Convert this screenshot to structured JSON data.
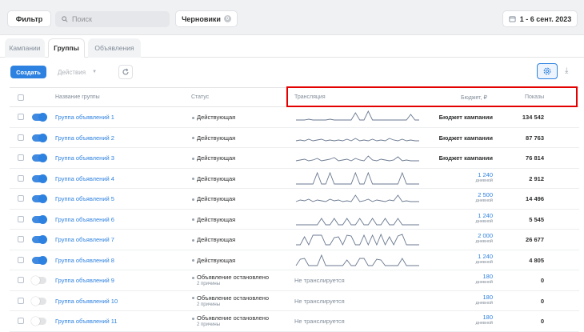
{
  "toolbar": {
    "filter_label": "Фильтр",
    "search_placeholder": "Поиск",
    "drafts_label": "Черновики",
    "drafts_count": "0",
    "date_range": "1 - 6 сент. 2023"
  },
  "tabs": [
    {
      "label": "Кампании",
      "active": false
    },
    {
      "label": "Группы",
      "active": true
    },
    {
      "label": "Объявления",
      "active": false
    }
  ],
  "actions": {
    "create_label": "Создать",
    "actions_label": "Действия"
  },
  "columns": {
    "name": "Название группы",
    "status": "Статус",
    "broadcast": "Трансляция",
    "budget": "Бюджет, ₽",
    "shows": "Показы"
  },
  "colors": {
    "accent": "#2d81e0",
    "highlight": "#e40000"
  },
  "rows": [
    {
      "name": "Группа объявлений 1",
      "active": true,
      "status": "Действующая",
      "reason": "",
      "broadcast": "spark",
      "budget": "Бюджет кампании",
      "budget_sub": "",
      "shows": "134 542"
    },
    {
      "name": "Группа объявлений 2",
      "active": true,
      "status": "Действующая",
      "reason": "",
      "broadcast": "spark",
      "budget": "Бюджет кампании",
      "budget_sub": "",
      "shows": "87 763"
    },
    {
      "name": "Группа объявлений 3",
      "active": true,
      "status": "Действующая",
      "reason": "",
      "broadcast": "spark",
      "budget": "Бюджет кампании",
      "budget_sub": "",
      "shows": "76 814"
    },
    {
      "name": "Группа объявлений 4",
      "active": true,
      "status": "Действующая",
      "reason": "",
      "broadcast": "spark",
      "budget": "1 240",
      "budget_sub": "дневной",
      "shows": "2 912"
    },
    {
      "name": "Группа объявлений 5",
      "active": true,
      "status": "Действующая",
      "reason": "",
      "broadcast": "spark",
      "budget": "2 500",
      "budget_sub": "дневной",
      "shows": "14 496"
    },
    {
      "name": "Группа объявлений 6",
      "active": true,
      "status": "Действующая",
      "reason": "",
      "broadcast": "spark",
      "budget": "1 240",
      "budget_sub": "дневной",
      "shows": "5 545"
    },
    {
      "name": "Группа объявлений 7",
      "active": true,
      "status": "Действующая",
      "reason": "",
      "broadcast": "spark",
      "budget": "2 000",
      "budget_sub": "дневной",
      "shows": "26 677"
    },
    {
      "name": "Группа объявлений 8",
      "active": true,
      "status": "Действующая",
      "reason": "",
      "broadcast": "spark",
      "budget": "1 240",
      "budget_sub": "дневной",
      "shows": "4 805"
    },
    {
      "name": "Группа объявлений 9",
      "active": false,
      "status": "Объявление остановлено",
      "reason": "2 причины",
      "broadcast": "Не транслируется",
      "budget": "180",
      "budget_sub": "дневной",
      "shows": "0"
    },
    {
      "name": "Группа объявлений 10",
      "active": false,
      "status": "Объявление остановлено",
      "reason": "2 причины",
      "broadcast": "Не транслируется",
      "budget": "180",
      "budget_sub": "дневной",
      "shows": "0"
    },
    {
      "name": "Группа объявлений 11",
      "active": false,
      "status": "Объявление остановлено",
      "reason": "2 причины",
      "broadcast": "Не транслируется",
      "budget": "180",
      "budget_sub": "дневной",
      "shows": "0"
    }
  ]
}
